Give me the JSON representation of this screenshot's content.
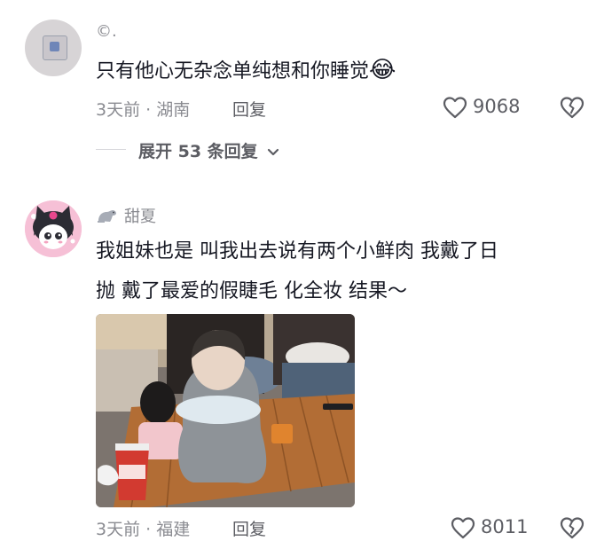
{
  "comments": [
    {
      "username": "©.",
      "text": "只有他心无杂念单纯想和你睡觉",
      "emoji": "😂",
      "time_location": "3天前 · 湖南",
      "reply_label": "回复",
      "like_count": "9068",
      "expand_replies": "展开 53 条回复"
    },
    {
      "username": "甜夏",
      "username_icon": "seal-icon",
      "text_line1": "我姐妹也是 叫我出去说有两个小鲜肉 我戴了日",
      "text_line2": "抛 戴了最爱的假睫毛 化全妆 结果～",
      "time_location": "3天前 · 福建",
      "reply_label": "回复",
      "like_count": "8011"
    }
  ],
  "icons": {
    "like": "heart-outline-icon",
    "dislike": "broken-heart-icon",
    "expand": "chevron-down-icon"
  }
}
